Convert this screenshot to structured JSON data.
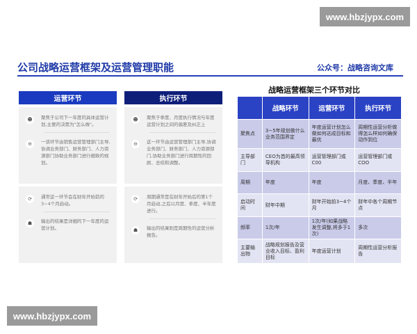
{
  "watermark": "www.hbzjypx.com",
  "title": "公司战略运营框架及运营管理职能",
  "account": "公众号：战略咨询文库",
  "columns": [
    {
      "header": "运营环节",
      "color": "#1a3bbf",
      "cards": [
        [
          {
            "icon": "person-icon",
            "text": "聚焦于公司下一年度的具体运营计划,主要的决策为\"怎么做\"。"
          },
          {
            "icon": "minus-circle-icon",
            "text": "一该环节由销售运营管理部门主导,协调业务部门、财务部门、人力资源部门协助业务部门进行细致的规划。"
          }
        ],
        [
          {
            "icon": "cycle-icon",
            "text": "通常这一环节会在财年开始前的3~4个月启动。"
          },
          {
            "icon": "head-icon",
            "text": "输出的结果是详细的下一年度的运营计划。"
          }
        ]
      ]
    },
    {
      "header": "执行环节",
      "color": "#0e1f7a",
      "cards": [
        [
          {
            "icon": "person-icon",
            "text": "聚焦于季度、月度执行情况与年度运营计划之间的偏差及纠正上"
          },
          {
            "icon": "minus-circle-icon",
            "text": "这一环节由运营管理部门主导,协调业务部门、财务部门、人力资源部门,协助业务部门进行周期性的回顾、总结和调整。"
          }
        ],
        [
          {
            "icon": "cycle-icon",
            "text": "周期通常是在财年开始后的第1个月启动,之后以月度、季度、半年度进行。"
          },
          {
            "icon": "head-icon",
            "text": "输出的结果则是周期性的运营分析报告。"
          }
        ]
      ]
    }
  ],
  "table": {
    "title": "战略运营框架三个环节对比",
    "headers": [
      "",
      "战略环节",
      "运营环节",
      "执行环节"
    ],
    "rows": [
      [
        "聚焦点",
        "3~5年规划做什么业务范围界定",
        "年度运营计划怎么做如何达成目标和最优",
        "周期性运营分析做得怎么样如何确保动作到位"
      ],
      [
        "主导部门",
        "CEO为首的最高领导机构",
        "运营管理部门或C00",
        "运营管理部门或COO"
      ],
      [
        "周期",
        "年度",
        "年度",
        "月度、季度、半年"
      ],
      [
        "启动时间",
        "财年中期",
        "财年开始前3~4个月",
        "财年中各个周期节点"
      ],
      [
        "频率",
        "1次/年",
        "1次/年(如果战略发生调整,将多于1次)",
        "多次"
      ],
      [
        "主要输出物",
        "战略规划报告及营业收入目标、盈利目标",
        "年度运营计划",
        "周期性运营分析报告"
      ]
    ]
  }
}
